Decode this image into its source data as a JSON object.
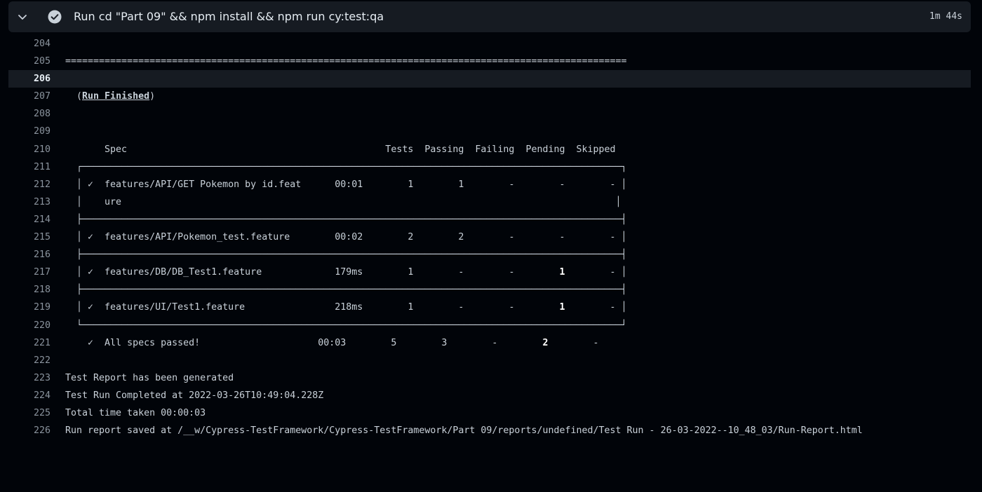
{
  "step": {
    "title": "Run cd \"Part 09\" && npm install && npm run cy:test:qa",
    "duration": "1m 44s",
    "status_icon": "check-circle-icon",
    "expand_icon": "chevron-down-icon"
  },
  "colors": {
    "background": "#010409",
    "header_bg": "#161b22",
    "text": "#c9d1d9",
    "line_number": "#8b949e"
  },
  "log": {
    "separator": "====================================================================================================",
    "run_finished_open": "  (",
    "run_finished_label": "Run Finished",
    "run_finished_close": ")",
    "table_header": "       Spec                                              Tests  Passing  Failing  Pending  Skipped",
    "border_top": "  ┌────────────────────────────────────────────────────────────────────────────────────────────────┐",
    "border_mid": "  ├────────────────────────────────────────────────────────────────────────────────────────────────┤",
    "border_bottom": "  └────────────────────────────────────────────────────────────────────────────────────────────────┘",
    "rows": [
      {
        "prefix": "  │ ✓  ",
        "spec": "features/API/GET Pokemon by id.feat",
        "rest": "      00:01        1        1        -        -        - │",
        "pending_bright": false
      },
      {
        "prefix": "  │    ",
        "spec": "ure",
        "rest": "                                                                                        │",
        "pending_bright": false
      },
      {
        "prefix": "  │ ✓  ",
        "spec": "features/API/Pokemon_test.feature",
        "rest": "        00:02        2        2        -        -        - │",
        "pending_bright": false
      },
      {
        "prefix": "  │ ✓  ",
        "spec": "features/DB/DB_Test1.feature",
        "rest_a": "             179ms        1        -        -        ",
        "pending": "1",
        "rest_b": "        - │"
      },
      {
        "prefix": "  │ ✓  ",
        "spec": "features/UI/Test1.feature",
        "rest_a": "                218ms        1        -        -        ",
        "pending": "1",
        "rest_b": "        - │"
      }
    ],
    "summary": {
      "prefix": "    ✓  ",
      "label": "All specs passed!",
      "rest_a": "                     00:03        5        3        -        ",
      "pending": "2",
      "rest_b": "        -"
    },
    "report_generated": "Test Report has been generated",
    "run_completed": "Test Run Completed at 2022-03-26T10:49:04.228Z",
    "total_time": "Total time taken 00:00:03",
    "report_saved": "Run report saved at /__w/Cypress-TestFramework/Cypress-TestFramework/Part 09/reports/undefined/Test Run - 26-03-2022--10_48_03/Run-Report.html"
  },
  "line_numbers": [
    "204",
    "205",
    "206",
    "207",
    "208",
    "209",
    "210",
    "211",
    "212",
    "213",
    "214",
    "215",
    "216",
    "217",
    "218",
    "219",
    "220",
    "221",
    "222",
    "223",
    "224",
    "225",
    "226"
  ]
}
